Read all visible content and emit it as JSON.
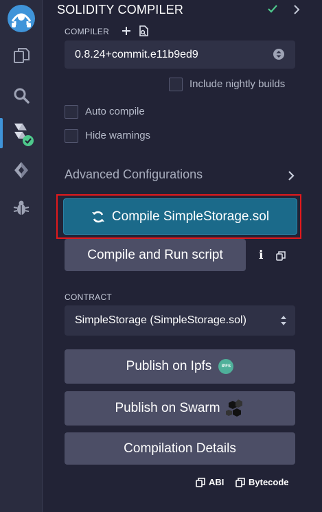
{
  "panel": {
    "title": "SOLIDITY COMPILER"
  },
  "compiler": {
    "label": "COMPILER",
    "version": "0.8.24+commit.e11b9ed9",
    "nightly_label": "Include nightly builds"
  },
  "options": {
    "auto_compile": "Auto compile",
    "hide_warnings": "Hide warnings"
  },
  "advanced": {
    "label": "Advanced Configurations"
  },
  "actions": {
    "compile": "Compile SimpleStorage.sol",
    "compile_run": "Compile and Run script",
    "info_glyph": "i"
  },
  "contract": {
    "label": "CONTRACT",
    "selected": "SimpleStorage (SimpleStorage.sol)"
  },
  "publish": {
    "ipfs": "Publish on Ipfs",
    "ipfs_badge": "IPFS",
    "swarm": "Publish on Swarm",
    "details": "Compilation Details"
  },
  "copy": {
    "abi": "ABI",
    "bytecode": "Bytecode"
  },
  "colors": {
    "accent": "#1b6a8a",
    "highlight": "#e3191c",
    "success": "#4ec98c"
  }
}
